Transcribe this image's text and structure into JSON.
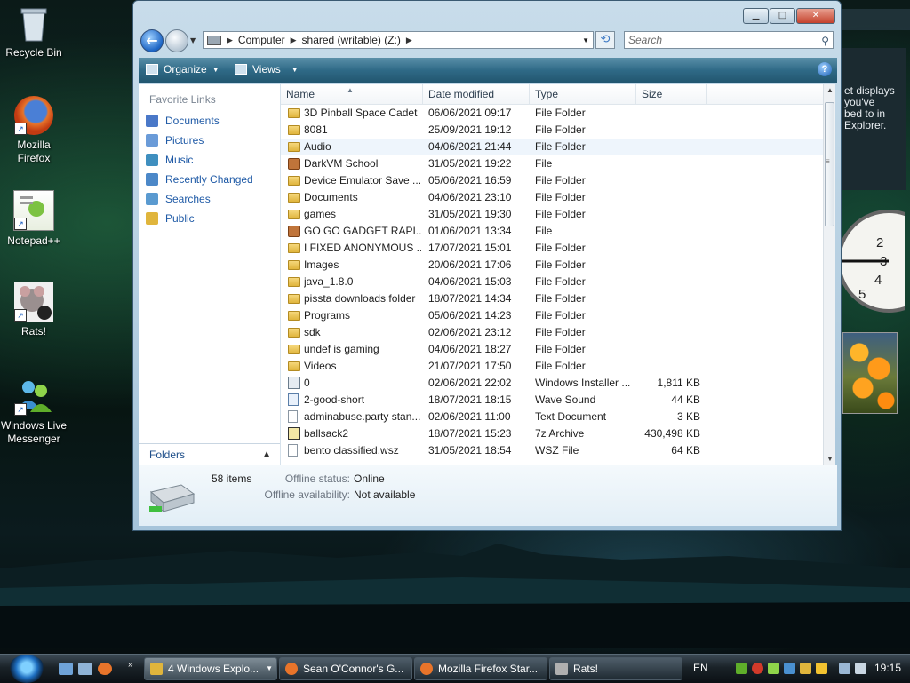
{
  "desktop": {
    "icons": [
      {
        "label": "Recycle Bin"
      },
      {
        "label": "Mozilla Firefox"
      },
      {
        "label": "Notepad++"
      },
      {
        "label": "Rats!"
      },
      {
        "label": "Windows Live Messenger"
      }
    ]
  },
  "gadgets": {
    "message_lines": [
      "et displays",
      "you've",
      "bed to in",
      "Explorer."
    ],
    "clock_numbers": [
      "2",
      "3",
      "4",
      "5"
    ]
  },
  "window": {
    "buttons": {
      "minimize": "▁",
      "maximize": "□",
      "close": "✕"
    },
    "address": {
      "crumbs": [
        "Computer",
        "shared (writable) (Z:)"
      ]
    },
    "search": {
      "placeholder": "Search"
    },
    "toolbar": {
      "organize": "Organize",
      "views": "Views"
    },
    "favorite_links": {
      "title": "Favorite Links",
      "items": [
        {
          "label": "Documents",
          "color": "#4a78c8"
        },
        {
          "label": "Pictures",
          "color": "#6a9bd8"
        },
        {
          "label": "Music",
          "color": "#3f8fbf"
        },
        {
          "label": "Recently Changed",
          "color": "#4c88c8"
        },
        {
          "label": "Searches",
          "color": "#5a9ad0"
        },
        {
          "label": "Public",
          "color": "#e0b53c"
        }
      ],
      "folders_label": "Folders"
    },
    "columns": {
      "name": "Name",
      "date": "Date modified",
      "type": "Type",
      "size": "Size"
    },
    "files": [
      {
        "name": "3D Pinball Space Cadet",
        "date": "06/06/2021 09:17",
        "type": "File Folder",
        "size": "",
        "icon": "folder"
      },
      {
        "name": "8081",
        "date": "25/09/2021 19:12",
        "type": "File Folder",
        "size": "",
        "icon": "folder"
      },
      {
        "name": "Audio",
        "date": "04/06/2021 21:44",
        "type": "File Folder",
        "size": "",
        "icon": "folder"
      },
      {
        "name": "DarkVM School",
        "date": "31/05/2021 19:22",
        "type": "File",
        "size": "",
        "icon": "box"
      },
      {
        "name": "Device Emulator Save ...",
        "date": "05/06/2021 16:59",
        "type": "File Folder",
        "size": "",
        "icon": "folder"
      },
      {
        "name": "Documents",
        "date": "04/06/2021 23:10",
        "type": "File Folder",
        "size": "",
        "icon": "folder"
      },
      {
        "name": "games",
        "date": "31/05/2021 19:30",
        "type": "File Folder",
        "size": "",
        "icon": "folder"
      },
      {
        "name": "GO GO GADGET RAPI...",
        "date": "01/06/2021 13:34",
        "type": "File",
        "size": "",
        "icon": "box"
      },
      {
        "name": "I FIXED ANONYMOUS ...",
        "date": "17/07/2021 15:01",
        "type": "File Folder",
        "size": "",
        "icon": "folder"
      },
      {
        "name": "Images",
        "date": "20/06/2021 17:06",
        "type": "File Folder",
        "size": "",
        "icon": "folder"
      },
      {
        "name": "java_1.8.0",
        "date": "04/06/2021 15:03",
        "type": "File Folder",
        "size": "",
        "icon": "folder"
      },
      {
        "name": "pissta downloads folder",
        "date": "18/07/2021 14:34",
        "type": "File Folder",
        "size": "",
        "icon": "folder"
      },
      {
        "name": "Programs",
        "date": "05/06/2021 14:23",
        "type": "File Folder",
        "size": "",
        "icon": "folder"
      },
      {
        "name": "sdk",
        "date": "02/06/2021 23:12",
        "type": "File Folder",
        "size": "",
        "icon": "folder"
      },
      {
        "name": "undef is gaming",
        "date": "04/06/2021 18:27",
        "type": "File Folder",
        "size": "",
        "icon": "folder"
      },
      {
        "name": "Videos",
        "date": "21/07/2021 17:50",
        "type": "File Folder",
        "size": "",
        "icon": "folder"
      },
      {
        "name": "0",
        "date": "02/06/2021 22:02",
        "type": "Windows Installer ...",
        "size": "1,811 KB",
        "icon": "installer"
      },
      {
        "name": "2-good-short",
        "date": "18/07/2021 18:15",
        "type": "Wave Sound",
        "size": "44 KB",
        "icon": "wave"
      },
      {
        "name": "adminabuse.party stan...",
        "date": "02/06/2021 11:00",
        "type": "Text Document",
        "size": "3 KB",
        "icon": "file"
      },
      {
        "name": "ballsack2",
        "date": "18/07/2021 15:23",
        "type": "7z Archive",
        "size": "430,498 KB",
        "icon": "zip"
      },
      {
        "name": "bento classified.wsz",
        "date": "31/05/2021 18:54",
        "type": "WSZ File",
        "size": "64 KB",
        "icon": "file"
      }
    ],
    "details": {
      "count": "58 items",
      "offline_status_label": "Offline status:",
      "offline_status_value": "Online",
      "offline_availability_label": "Offline availability:",
      "offline_availability_value": "Not available"
    }
  },
  "taskbar": {
    "buttons": [
      {
        "label": "4 Windows Explo...",
        "active": true,
        "color": "#e0b53c"
      },
      {
        "label": "Sean O'Connor's G...",
        "active": false,
        "color": "#e8742a"
      },
      {
        "label": "Mozilla Firefox Star...",
        "active": false,
        "color": "#e8742a"
      },
      {
        "label": "Rats!",
        "active": false,
        "color": "#b0b0b0"
      }
    ],
    "language": "EN",
    "time": "19:15"
  }
}
